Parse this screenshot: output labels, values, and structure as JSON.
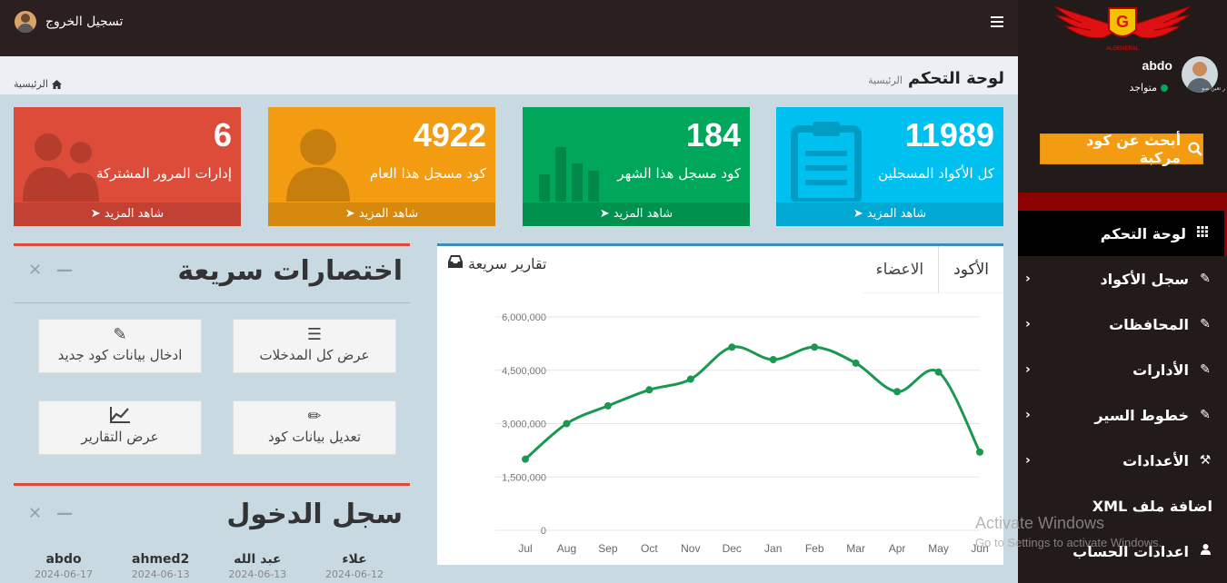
{
  "topbar": {
    "logout_label": "تسجيل الخروج"
  },
  "sidebar": {
    "logo_letter": "G",
    "logo_text": "ALGENERAL",
    "user": {
      "name": "abdo",
      "status": "متواجد",
      "avatar_caption": "ر تعين صو"
    },
    "search_label": "أبحث عن كود مركبة",
    "menu": [
      {
        "label": "لوحة التحكم",
        "icon": "grid-icon",
        "active": true
      },
      {
        "label": "سجل الأكواد",
        "icon": "edit-icon"
      },
      {
        "label": "المحافظات",
        "icon": "edit-icon"
      },
      {
        "label": "الأدارات",
        "icon": "edit-icon"
      },
      {
        "label": "خطوط السير",
        "icon": "edit-icon"
      },
      {
        "label": "الأعدادات",
        "icon": "tools-icon"
      },
      {
        "label": "اضافة ملف XML",
        "icon": ""
      },
      {
        "label": "اعدادات الحساب",
        "icon": "user-icon"
      }
    ]
  },
  "header": {
    "title": "لوحة التحكم",
    "subtitle": "الرئيسية",
    "breadcrumb": "الرئيسية"
  },
  "stats": [
    {
      "value": "11989",
      "label": "كل الأكواد المسجلين",
      "more": "شاهد المزيد",
      "color": "#00c0ef",
      "icon": "clipboard-icon"
    },
    {
      "value": "184",
      "label": "كود مسجل هذا الشهر",
      "more": "شاهد المزيد",
      "color": "#00a65a",
      "icon": "bar-chart-icon"
    },
    {
      "value": "4922",
      "label": "كود مسجل هذا العام",
      "more": "شاهد المزيد",
      "color": "#f39c12",
      "icon": "user-icon"
    },
    {
      "value": "6",
      "label": "إدارات المرور المشتركة",
      "more": "شاهد المزيد",
      "color": "#dd4b39",
      "icon": "users-icon"
    }
  ],
  "shortcuts": {
    "title": "اختصارات سريعة",
    "buttons": [
      {
        "label": "عرض كل المدخلات",
        "icon": "list-icon"
      },
      {
        "label": "ادخال بيانات كود جديد",
        "icon": "edit-icon"
      },
      {
        "label": "تعديل بيانات كود",
        "icon": "pencil-icon"
      },
      {
        "label": "عرض التقارير",
        "icon": "line-chart-icon"
      }
    ]
  },
  "login_log": {
    "title": "سجل الدخول",
    "entries": [
      {
        "name": "علاء",
        "date": "2024-06-12"
      },
      {
        "name": "عبد الله",
        "date": "2024-06-13"
      },
      {
        "name": "ahmed2",
        "date": "2024-06-13"
      },
      {
        "name": "abdo",
        "date": "2024-06-17"
      }
    ]
  },
  "reports": {
    "title": "تقارير سريعة",
    "tabs": [
      "الأكود",
      "الاعضاء"
    ],
    "active_tab": 0
  },
  "chart_data": {
    "type": "line",
    "categories": [
      "Jul",
      "Aug",
      "Sep",
      "Oct",
      "Nov",
      "Dec",
      "Jan",
      "Feb",
      "Mar",
      "Apr",
      "May",
      "Jun"
    ],
    "values": [
      2000000,
      3000000,
      3500000,
      3950000,
      4250000,
      5150000,
      4800000,
      5150000,
      4700000,
      3900000,
      4450000,
      2200000
    ],
    "yticks": [
      "0",
      "1,500,000",
      "3,000,000",
      "4,500,000",
      "6,000,000"
    ],
    "ylim": [
      0,
      6000000
    ],
    "color": "#1a9850",
    "grid": true
  },
  "watermark": {
    "line1": "Activate Windows",
    "line2": "Go to Settings to activate Windows."
  }
}
